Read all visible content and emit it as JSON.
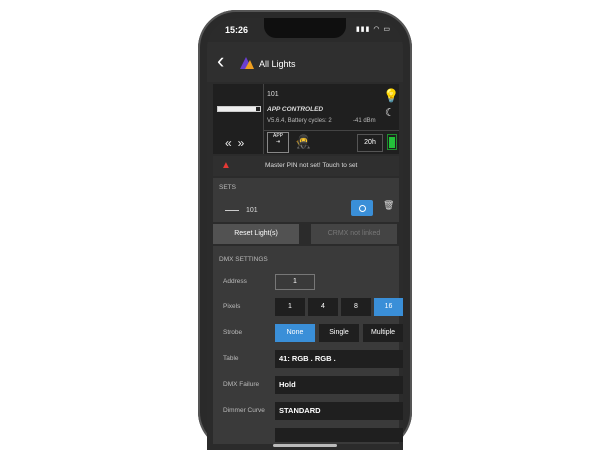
{
  "status": {
    "time": "15:26"
  },
  "nav": {
    "back": "‹",
    "title": "All Lights",
    "back_icon": "chevron-left-icon"
  },
  "device": {
    "name": "101",
    "mode": "APP CONTROLED",
    "version": "V5.6.4, Battery cycles: 2",
    "rssi": "-41 dBm",
    "bar_level": 0.9,
    "arrows": "«»",
    "app_label": "APP",
    "hours": "20h",
    "battery_level": 0.9
  },
  "alert": {
    "text": "Master PIN not set! Touch to set"
  },
  "sets": {
    "header": "SETS",
    "items": [
      {
        "name": "101"
      }
    ]
  },
  "buttons": {
    "reset": "Reset Light(s)",
    "cmx": "CRMX not linked"
  },
  "dmx": {
    "header": "DMX SETTINGS",
    "address_label": "Address",
    "address_value": "1",
    "pixels_label": "Pixels",
    "pixels_options": [
      "1",
      "4",
      "8",
      "16"
    ],
    "pixels_selected": "16",
    "strobe_label": "Strobe",
    "strobe_options": [
      "None",
      "Single",
      "Multiple"
    ],
    "strobe_selected": "None",
    "table_label": "Table",
    "table_value": "41: RGB . RGB .",
    "failure_label": "DMX Failure",
    "failure_value": "Hold",
    "curve_label": "Dimmer Curve",
    "curve_value": "STANDARD"
  },
  "colors": {
    "accent": "#3a8fd8",
    "alert": "#e53935",
    "battery": "#23c23a"
  }
}
